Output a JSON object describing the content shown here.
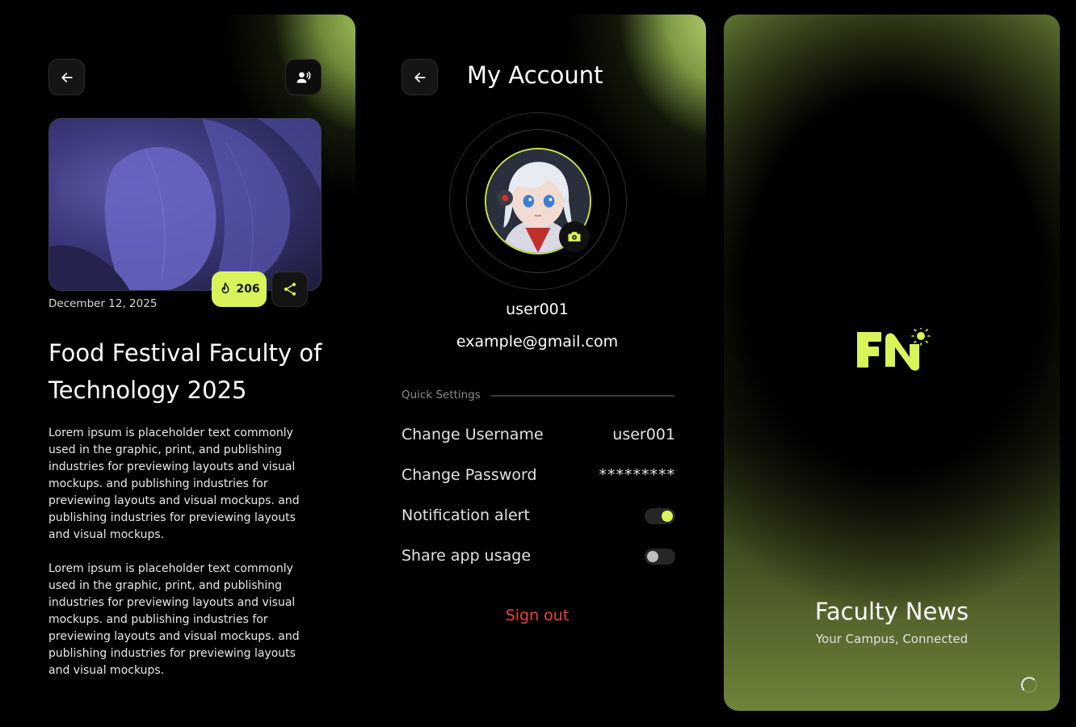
{
  "article_screen": {
    "date": "December 12, 2025",
    "title": "Food Festival Faculty of Technology 2025",
    "likes": "206",
    "paragraphs": [
      "Lorem ipsum is placeholder text commonly used in the graphic, print, and publishing industries for previewing layouts and visual mockups. and publishing industries for previewing layouts and visual mockups. and publishing industries for previewing layouts and visual mockups.",
      "Lorem ipsum is placeholder text commonly used in the graphic, print, and publishing industries for previewing layouts and visual mockups. and publishing industries for previewing layouts and visual mockups. and publishing industries for previewing layouts and visual mockups."
    ],
    "icons": {
      "back": "arrow-left-icon",
      "audio": "speaking-person-icon",
      "likes": "fire-icon",
      "share": "share-icon"
    }
  },
  "account_screen": {
    "title": "My Account",
    "username": "user001",
    "email": "example@gmail.com",
    "quick_settings_label": "Quick Settings",
    "settings": [
      {
        "label": "Change Username",
        "value": "user001"
      },
      {
        "label": "Change Password",
        "value": "*********"
      },
      {
        "label": "Notification alert",
        "toggle": true
      },
      {
        "label": "Share app usage",
        "toggle": false
      }
    ],
    "sign_out": "Sign out",
    "icons": {
      "back": "arrow-left-icon",
      "camera": "camera-icon"
    }
  },
  "splash_screen": {
    "logo": "FN",
    "brand": "Faculty News",
    "tagline": "Your Campus, Connected"
  },
  "colors": {
    "accent": "#d9f45a",
    "danger": "#f0403a",
    "background": "#000000"
  }
}
